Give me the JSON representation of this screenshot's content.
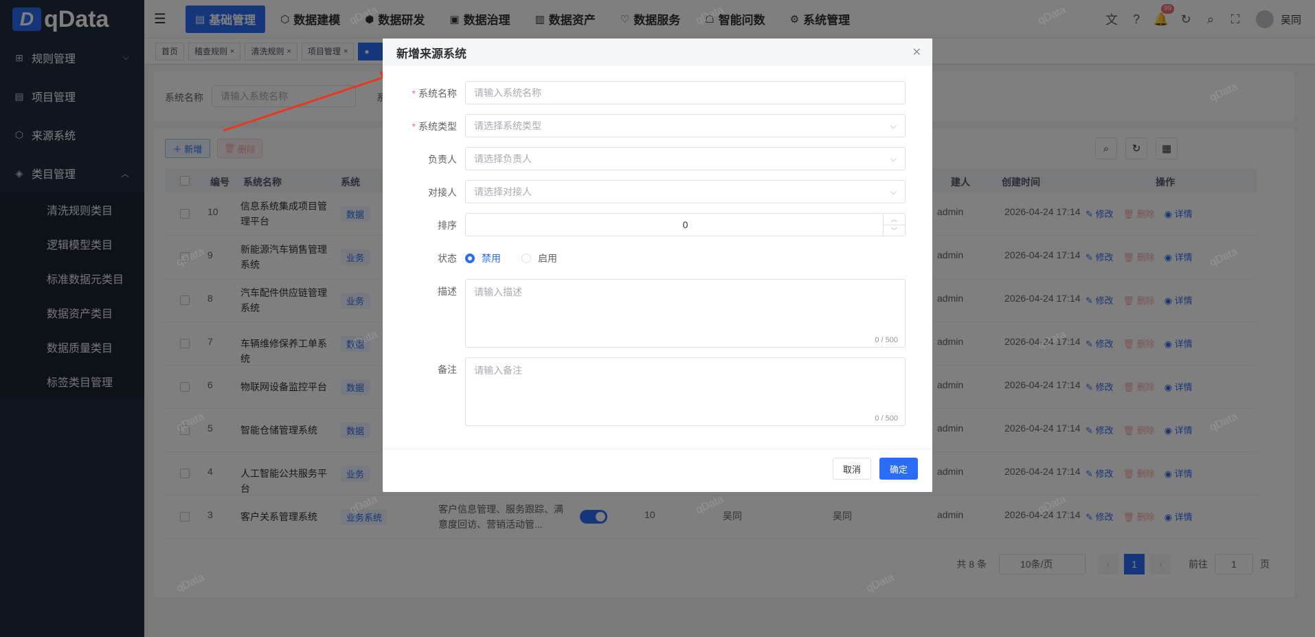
{
  "app": {
    "logo_mark": "D",
    "logo_text": "qData"
  },
  "sidebar": {
    "items": [
      {
        "label": "规则管理",
        "icon": "grid-icon"
      },
      {
        "label": "项目管理",
        "icon": "document-icon"
      },
      {
        "label": "来源系统",
        "icon": "cube-icon"
      },
      {
        "label": "类目管理",
        "icon": "layers-icon"
      }
    ],
    "subitems": [
      "清洗规则类目",
      "逻辑模型类目",
      "标准数据元类目",
      "数据资产类目",
      "数据质量类目",
      "标签类目管理"
    ]
  },
  "header": {
    "nav": [
      {
        "label": "基础管理",
        "active": true
      },
      {
        "label": "数据建模"
      },
      {
        "label": "数据研发"
      },
      {
        "label": "数据治理"
      },
      {
        "label": "数据资产"
      },
      {
        "label": "数据服务"
      },
      {
        "label": "智能问数"
      },
      {
        "label": "系统管理"
      }
    ],
    "badge": "99",
    "username": "吴同"
  },
  "tags": [
    "首页",
    "稽查规则",
    "清洗规则",
    "项目管理"
  ],
  "filter": {
    "label": "系统名称",
    "placeholder": "请输入系统名称",
    "second_label_partial": "系"
  },
  "toolbar": {
    "add": "新增",
    "delete": "删除"
  },
  "table": {
    "headers": {
      "id": "编号",
      "name": "系统名称",
      "type_partial": "系统",
      "creator_partial": "建人",
      "created": "创建时间",
      "ops": "操作"
    },
    "rows": [
      {
        "id": "10",
        "name": "信息系统集成项目管理平台",
        "type": "数据",
        "creator": "admin",
        "time": "2026-04-24 17:14"
      },
      {
        "id": "9",
        "name": "新能源汽车销售管理系统",
        "type": "业务",
        "creator": "admin",
        "time": "2026-04-24 17:14"
      },
      {
        "id": "8",
        "name": "汽车配件供应链管理系统",
        "type": "业务",
        "creator": "admin",
        "time": "2026-04-24 17:14"
      },
      {
        "id": "7",
        "name": "车辆维修保养工单系统",
        "type": "数据",
        "creator": "admin",
        "time": "2026-04-24 17:14"
      },
      {
        "id": "6",
        "name": "物联网设备监控平台",
        "type": "数据",
        "creator": "admin",
        "time": "2026-04-24 17:14"
      },
      {
        "id": "5",
        "name": "智能仓储管理系统",
        "type": "数据",
        "creator": "admin",
        "time": "2026-04-24 17:14"
      },
      {
        "id": "4",
        "name": "人工智能公共服务平台",
        "type": "业务",
        "creator": "admin",
        "time": "2026-04-24 17:14"
      },
      {
        "id": "3",
        "name": "客户关系管理系统",
        "type": "业务系统",
        "creator": "admin",
        "time": "2026-04-24 17:14",
        "desc": "客户信息管理、服务跟踪、满意度回访、营销活动管...",
        "sort": "10",
        "owner": "吴同",
        "contact": "吴同"
      }
    ],
    "ops": {
      "edit": "修改",
      "delete": "删除",
      "detail": "详情"
    }
  },
  "pager": {
    "total": "共 8 条",
    "size": "10条/页",
    "page": "1",
    "goto": "前往",
    "goto_val": "1",
    "unit": "页"
  },
  "watermark": "qData",
  "dialog": {
    "title": "新增来源系统",
    "fields": {
      "name": {
        "label": "系统名称",
        "placeholder": "请输入系统名称"
      },
      "type": {
        "label": "系统类型",
        "placeholder": "请选择系统类型"
      },
      "owner": {
        "label": "负责人",
        "placeholder": "请选择负责人"
      },
      "contact": {
        "label": "对接人",
        "placeholder": "请选择对接人"
      },
      "sort": {
        "label": "排序",
        "value": "0"
      },
      "status": {
        "label": "状态",
        "options": [
          "禁用",
          "启用"
        ],
        "selected": "禁用"
      },
      "desc": {
        "label": "描述",
        "placeholder": "请输入描述",
        "count": "0 / 500"
      },
      "remark": {
        "label": "备注",
        "placeholder": "请输入备注",
        "count": "0 / 500"
      }
    },
    "cancel": "取消",
    "ok": "确定"
  },
  "colors": {
    "primary": "#2b6cf5",
    "sidebar": "#1f2d3d",
    "danger": "#f56c6c"
  }
}
